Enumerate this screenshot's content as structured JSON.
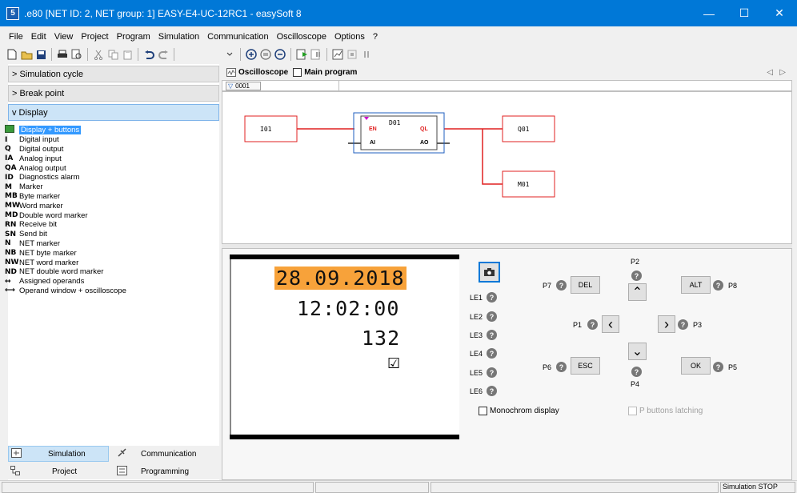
{
  "window": {
    "app_icon": "5",
    "title": ".e80 [NET ID: 2, NET group: 1] EASY-E4-UC-12RC1 - easySoft 8",
    "minimize": "—",
    "maximize": "☐",
    "close": "✕"
  },
  "menu": [
    "File",
    "Edit",
    "View",
    "Project",
    "Program",
    "Simulation",
    "Communication",
    "Oscilloscope",
    "Options",
    "?"
  ],
  "toolbar_icons": [
    "new-icon",
    "open-icon",
    "save-icon",
    "print-icon",
    "print-preview-icon",
    "cut-icon",
    "copy-icon",
    "paste-icon",
    "undo-icon",
    "redo-icon",
    "dropdown-icon",
    "zoom-in-icon",
    "zoom-reset-icon",
    "zoom-out-icon",
    "sim-start-icon",
    "sim-step-icon",
    "sim-chart-icon",
    "sim-stop-icon",
    "sim-pause-icon"
  ],
  "sections": {
    "sim_cycle": "> Simulation cycle",
    "break_point": "> Break point",
    "display": "v Display"
  },
  "tree": [
    {
      "icon": "▣",
      "label": "Display + buttons"
    },
    {
      "icon": "I",
      "label": "Digital input"
    },
    {
      "icon": "Q",
      "label": "Digital output"
    },
    {
      "icon": "IA",
      "label": "Analog input"
    },
    {
      "icon": "QA",
      "label": "Analog output"
    },
    {
      "icon": "ID",
      "label": "Diagnostics alarm"
    },
    {
      "icon": "M",
      "label": "Marker"
    },
    {
      "icon": "MB",
      "label": "Byte marker"
    },
    {
      "icon": "MW",
      "label": "Word marker"
    },
    {
      "icon": "MD",
      "label": "Double word marker"
    },
    {
      "icon": "RN",
      "label": "Receive bit"
    },
    {
      "icon": "SN",
      "label": "Send bit"
    },
    {
      "icon": "N",
      "label": "NET marker"
    },
    {
      "icon": "NB",
      "label": "NET byte marker"
    },
    {
      "icon": "NW",
      "label": "NET word marker"
    },
    {
      "icon": "ND",
      "label": "NET double word marker"
    },
    {
      "icon": "↔",
      "label": "Assigned operands"
    },
    {
      "icon": "⟷",
      "label": "Operand window + oscilloscope"
    }
  ],
  "bottom_nav": {
    "simulation": "Simulation",
    "communication": "Communication",
    "project": "Project",
    "programming": "Programming"
  },
  "workspace": {
    "oscilloscope": "Oscilloscope",
    "main_program": "Main program",
    "scroll_left": "◁",
    "scroll_right": "▷",
    "tab": "0001"
  },
  "diagram": {
    "input": "I01",
    "block": "D01",
    "en": "EN",
    "ql": "QL",
    "ai": "AI",
    "ao": "AO",
    "out1": "Q01",
    "out2": "M01"
  },
  "lcd": {
    "date": "28.09.2018",
    "time": "12:02:00",
    "value": "132",
    "check": "☑"
  },
  "panel": {
    "camera": "camera-icon",
    "le": [
      "LE1",
      "LE2",
      "LE3",
      "LE4",
      "LE5",
      "LE6"
    ],
    "help": "?",
    "p_labels": {
      "p1": "P1",
      "p2": "P2",
      "p3": "P3",
      "p4": "P4",
      "p5": "P5",
      "p6": "P6",
      "p7": "P7",
      "p8": "P8"
    },
    "buttons": {
      "del": "DEL",
      "alt": "ALT",
      "esc": "ESC",
      "ok": "OK",
      "up": "⌃",
      "down": "⌄",
      "left": "‹",
      "right": "›"
    },
    "monochrom": "Monochrom display",
    "latching": "P buttons latching"
  },
  "status": {
    "right": "Simulation STOP"
  },
  "colors": {
    "titlebar": "#0078d7",
    "date_highlight": "#f7a23a",
    "wire": "#e02020",
    "block_border": "#1f5fbf",
    "selection": "#3399ff"
  }
}
